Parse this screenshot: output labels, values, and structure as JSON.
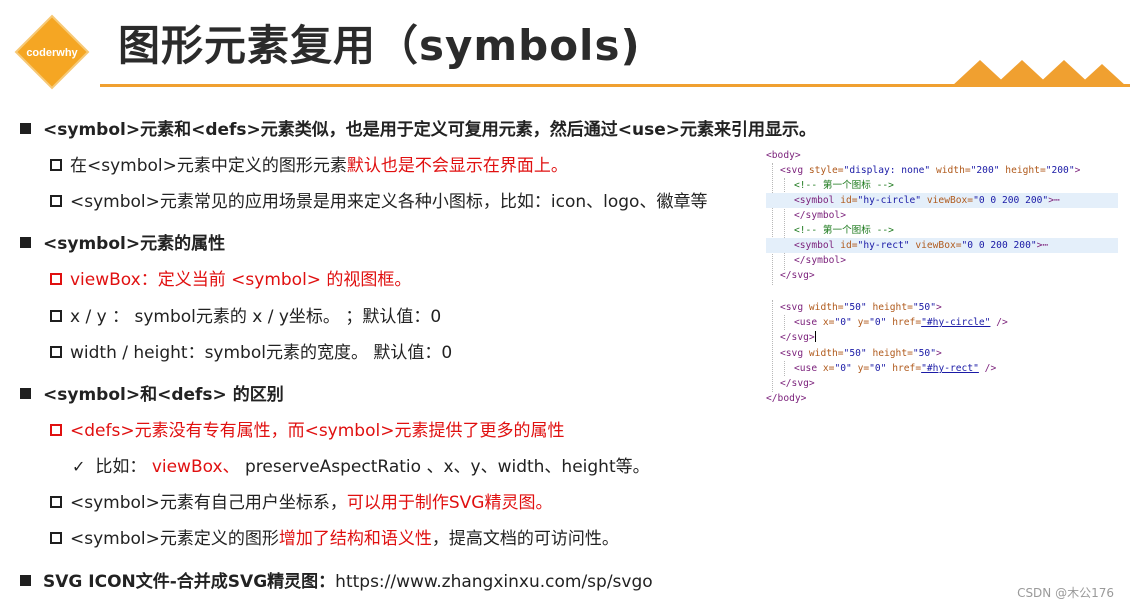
{
  "header": {
    "logo_text": "coderwhy",
    "title": "图形元素复用（symbols)"
  },
  "colors": {
    "accent": "#f0a030",
    "highlight_red": "#e01010"
  },
  "content": {
    "b1": "<symbol>元素和<defs>元素类似，也是用于定义可复用元素，然后通过<use>元素来引用显示。",
    "b1_1_a": "在<symbol>元素中定义的图形元素",
    "b1_1_b": "默认也是不会显示在界面上。",
    "b1_2": "<symbol>元素常见的应用场景是用来定义各种小图标，比如：icon、logo、徽章等",
    "b2": "<symbol>元素的属性",
    "b2_1": "viewBox：定义当前 <symbol> 的视图框。",
    "b2_2": "x / y ： symbol元素的 x / y坐标。 ；默认值：0",
    "b2_3": "width / height：symbol元素的宽度。 默认值：0",
    "b3": "<symbol>和<defs> 的区别",
    "b3_1": "<defs>元素没有专有属性，而<symbol>元素提供了更多的属性",
    "b3_1_1_a": "比如：",
    "b3_1_1_b": "viewBox、",
    "b3_1_1_c": "preserveAspectRatio 、x、y、width、height等。",
    "b3_2_a": "<symbol>元素有自己用户坐标系，",
    "b3_2_b": "可以用于制作SVG精灵图。",
    "b3_3_a": "<symbol>元素定义的图形",
    "b3_3_b": "增加了结构和语义性",
    "b3_3_c": "，提高文档的可访问性。",
    "b4_a": "SVG ICON文件-合并成SVG精灵图：",
    "b4_b": "https://www.zhangxinxu.com/sp/svgo"
  },
  "code": {
    "c1": "<body>",
    "c2_tag": "<svg",
    "c2_a1": "style=",
    "c2_v1": "\"display: none\"",
    "c2_a2": "width=",
    "c2_v2": "\"200\"",
    "c2_a3": "height=",
    "c2_v3": "\"200\"",
    "c2_end": ">",
    "c3": "<!-- 第一个图标 -->",
    "c4_tag": "<symbol",
    "c4_a1": "id=",
    "c4_v1": "\"hy-circle\"",
    "c4_a2": "viewBox=",
    "c4_v2": "\"0 0 200 200\"",
    "c4_end": ">⋯",
    "c5": "</symbol>",
    "c6": "<!-- 第一个图标 -->",
    "c7_tag": "<symbol",
    "c7_a1": "id=",
    "c7_v1": "\"hy-rect\"",
    "c7_a2": "viewBox=",
    "c7_v2": "\"0 0 200 200\"",
    "c7_end": ">⋯",
    "c8": "</symbol>",
    "c9": "</svg>",
    "c10_tag": "<svg",
    "c10_a1": "width=",
    "c10_v1": "\"50\"",
    "c10_a2": "height=",
    "c10_v2": "\"50\"",
    "c10_end": ">",
    "c11_tag": "<use",
    "c11_a1": "x=",
    "c11_v1": "\"0\"",
    "c11_a2": "y=",
    "c11_v2": "\"0\"",
    "c11_a3": "href=",
    "c11_v3": "\"#hy-circle\"",
    "c11_end": "/>",
    "c12": "</svg>",
    "c13_tag": "<svg",
    "c13_a1": "width=",
    "c13_v1": "\"50\"",
    "c13_a2": "height=",
    "c13_v2": "\"50\"",
    "c13_end": ">",
    "c14_tag": "<use",
    "c14_a1": "x=",
    "c14_v1": "\"0\"",
    "c14_a2": "y=",
    "c14_v2": "\"0\"",
    "c14_a3": "href=",
    "c14_v3": "\"#hy-rect\"",
    "c14_end": "/>",
    "c15": "</svg>",
    "c16": "</body>"
  },
  "watermark": "CSDN @木公176"
}
